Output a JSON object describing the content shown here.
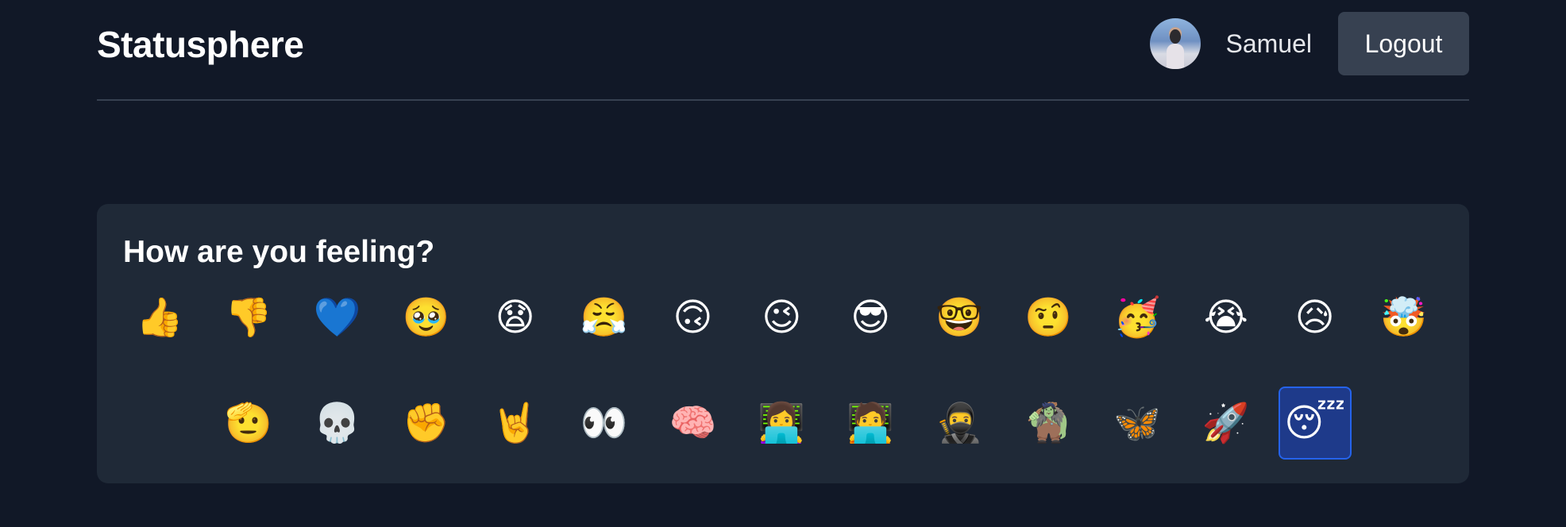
{
  "header": {
    "brand": "Statusphere",
    "username": "Samuel",
    "logout_label": "Logout"
  },
  "card": {
    "title": "How are you feeling?"
  },
  "emojis_row1": [
    "👍",
    "👎",
    "💙",
    "🥹",
    "😧",
    "😤",
    "🙃",
    "😉",
    "😎",
    "🤓",
    "🤨",
    "🥳",
    "😭",
    "😥",
    "🤯"
  ],
  "emojis_row2": [
    "🫡",
    "💀",
    "✊",
    "🤘",
    "👀",
    "🧠",
    "👩‍💻",
    "🧑‍💻",
    "🥷",
    "🧌",
    "🦋",
    "🚀",
    "😴"
  ],
  "selected_emoji": "😴",
  "colors": {
    "background": "#111827",
    "card": "#1f2937",
    "button": "#374151",
    "selected_bg": "#1e3a8a",
    "selected_border": "#2563eb"
  }
}
